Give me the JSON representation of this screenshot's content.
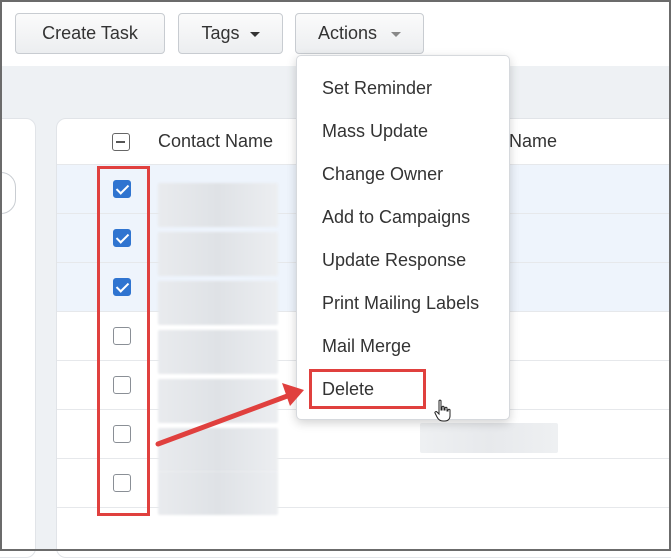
{
  "toolbar": {
    "create_task": "Create Task",
    "tags": "Tags",
    "actions": "Actions"
  },
  "table": {
    "headers": [
      "Contact Name",
      "Name"
    ],
    "rows": [
      {
        "checked": true
      },
      {
        "checked": true
      },
      {
        "checked": true
      },
      {
        "checked": false
      },
      {
        "checked": false
      },
      {
        "checked": false
      },
      {
        "checked": false
      }
    ]
  },
  "actions_menu": {
    "items": [
      "Set Reminder",
      "Mass Update",
      "Change Owner",
      "Add to Campaigns",
      "Update Response",
      "Print Mailing Labels",
      "Mail Merge",
      "Delete"
    ]
  },
  "colors": {
    "accent": "#2f74d0",
    "annotation": "#e0403e",
    "selected_row": "#eef4fc"
  },
  "icons": [
    "caret-down-icon",
    "checkbox-icon",
    "hand-cursor-icon",
    "arrow-annotation-icon"
  ]
}
